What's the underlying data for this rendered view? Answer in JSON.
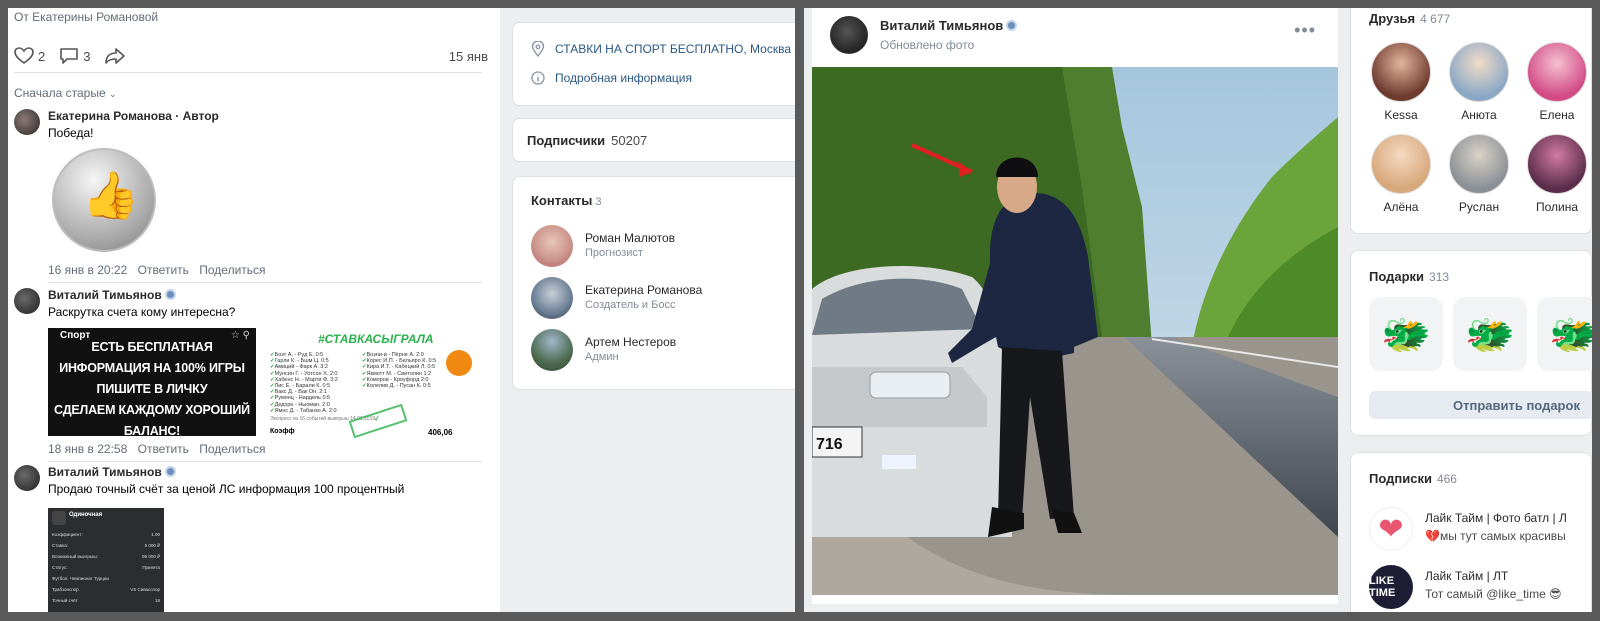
{
  "left": {
    "post_from": "От Екатерины Романовой",
    "likes": "2",
    "comments": "3",
    "post_date": "15 янв",
    "sort_label": "Сначала старые",
    "comments_list": [
      {
        "author": "Екатерина Романова · Автор",
        "text": "Победа!",
        "date": "16 янв в 20:22",
        "reply": "Ответить",
        "share": "Поделиться"
      },
      {
        "author": "Виталий Тимьянов",
        "text": "Раскрутка счета кому интересна?",
        "date": "18 янв в 22:58",
        "reply": "Ответить",
        "share": "Поделиться"
      },
      {
        "author": "Виталий Тимьянов",
        "text": "Продаю точный счёт за ценой ЛС информация 100 процентный"
      }
    ],
    "promo": {
      "header": "Спорт",
      "lines": [
        "ЕСТЬ БЕСПЛАТНАЯ",
        "ИНФОРМАЦИЯ НА 100% ИГРЫ",
        "ПИШИТЕ В ЛИЧКУ",
        "СДЕЛАЕМ КАЖДОМУ ХОРОШИЙ",
        "БАЛАНС!"
      ]
    },
    "slip": {
      "title": "#СТАВКАСЫГРАЛА",
      "rows": [
        "Бозт А. - Руд Е. 0:5",
        "Гарли К. - Бшм Ц. 0:5",
        "Амиций - Фарк А. 3:2",
        "Мунсин Г. - Уотсон Х. 2:0",
        "Хабенс Н. - Марти Ф. 3:2",
        "Лис Е. - Барали К. 0:5",
        "Вакс Д. - Вак Он. 2:1",
        "Румянц - Нардель 0:5",
        "Дедэрн - Ньюман. 2:0",
        "Ямнс Д. - Табанзо А. 2:0"
      ],
      "rows_right": [
        "Возни-и - Пёрне А. 2:0",
        "Корес И.П. - Бельяро К. 0:5",
        "Кира И.Т. - Кабецкий Л. 0:5",
        "Якмотт М. - Свитолин 1:2",
        "Коморов - Кроуфорд 2:0",
        "Колелив Д. - Пусан К. 0:5"
      ],
      "note": "Экспресс из 16 событий выигрыш 14.01.2019",
      "koef": "Коэфф",
      "sum": "406,06"
    },
    "ticket": {
      "title": "Одиночная",
      "rows": [
        [
          "Коэффициент:",
          "1.00"
        ],
        [
          "Ставка:",
          "5 000 ₽"
        ],
        [
          "Возможный выигрыш:",
          "95 000 ₽"
        ],
        [
          "Статус:",
          "Принята"
        ],
        [
          "Футбол. Чемпионат Турции",
          ""
        ],
        [
          "Трабзонспор",
          "VS  Сивасспор"
        ],
        [
          "Точный счёт",
          "19"
        ]
      ]
    },
    "aside": {
      "location": "СТАВКИ НА СПОРТ БЕСПЛАТНО, Москва",
      "more_info": "Подробная информация",
      "subscribers_label": "Подписчики",
      "subscribers_count": "50207",
      "contacts_label": "Контакты",
      "contacts_count": "3",
      "contacts": [
        {
          "name": "Роман Малютов",
          "role": "Прогнозист",
          "color": "#c98f88"
        },
        {
          "name": "Екатерина Романова",
          "role": "Создатель и Босс",
          "color": "#6b7e95"
        },
        {
          "name": "Артем Нестеров",
          "role": "Админ",
          "color": "#4d6b4e"
        }
      ]
    }
  },
  "right": {
    "user_name": "Виталий Тимьянов",
    "post_subtitle": "Обновлено фото",
    "more": "•••",
    "plate": "716",
    "friends_label": "Друзья",
    "friends_count": "4 677",
    "friends": [
      {
        "name": "Kessa",
        "color": "#6d3a2e"
      },
      {
        "name": "Анюта",
        "color": "#8aa7c6"
      },
      {
        "name": "Елена",
        "color": "#d24a86"
      },
      {
        "name": "Алёна",
        "color": "#d8a77a"
      },
      {
        "name": "Руслан",
        "color": "#8a8f95"
      },
      {
        "name": "Полина",
        "color": "#5a2d4a"
      }
    ],
    "gifts_label": "Подарки",
    "gifts_count": "313",
    "send_gift": "Отправить подарок",
    "subs_label": "Подписки",
    "subs_count": "466",
    "subs": [
      {
        "name": "Лайк Тайм | Фото батл | Л",
        "desc": "💔мы тут самых красивы",
        "logo": "",
        "color": "#ffffff"
      },
      {
        "name": "Лайк Тайм | ЛТ",
        "desc": "Тот самый @like_time 😎",
        "logo": "LIKE TIME",
        "color": "#1d1d35"
      }
    ]
  }
}
